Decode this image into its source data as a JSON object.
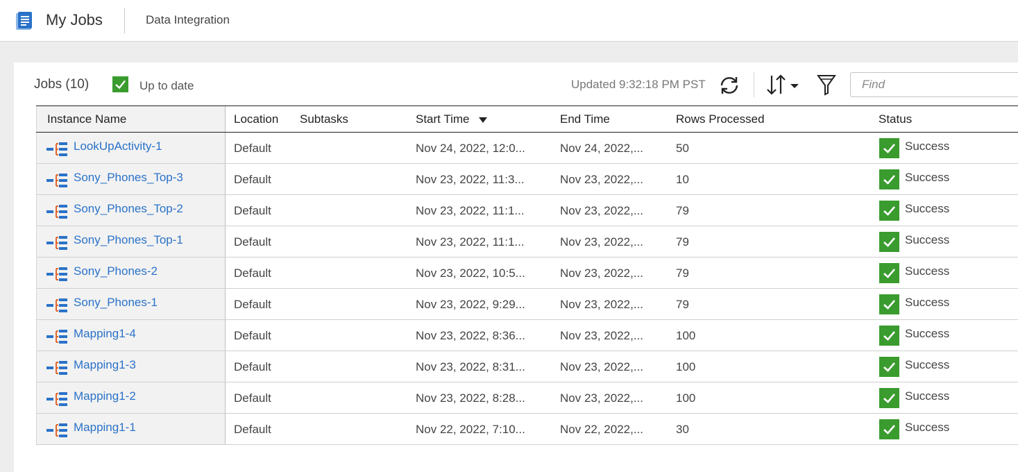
{
  "header": {
    "title": "My Jobs",
    "subtitle": "Data Integration"
  },
  "toolbar": {
    "jobs_label": "Jobs (10)",
    "uptodate_label": "Up to date",
    "updated_text": "Updated 9:32:18 PM PST",
    "find_placeholder": "Find"
  },
  "columns": {
    "instance_name": "Instance Name",
    "location": "Location",
    "subtasks": "Subtasks",
    "start_time": "Start Time",
    "end_time": "End Time",
    "rows_processed": "Rows Processed",
    "status": "Status"
  },
  "colors": {
    "link": "#2a72c8",
    "success": "#3a9b2e",
    "icon_blue": "#2a72c8",
    "icon_orange": "#e0662a"
  },
  "rows": [
    {
      "name": "LookUpActivity-1",
      "location": "Default",
      "start": "Nov 24, 2022, 12:0...",
      "end": "Nov 24, 2022,...",
      "rows": "50",
      "status": "Success"
    },
    {
      "name": "Sony_Phones_Top-3",
      "location": "Default",
      "start": "Nov 23, 2022, 11:3...",
      "end": "Nov 23, 2022,...",
      "rows": "10",
      "status": "Success"
    },
    {
      "name": "Sony_Phones_Top-2",
      "location": "Default",
      "start": "Nov 23, 2022, 11:1...",
      "end": "Nov 23, 2022,...",
      "rows": "79",
      "status": "Success"
    },
    {
      "name": "Sony_Phones_Top-1",
      "location": "Default",
      "start": "Nov 23, 2022, 11:1...",
      "end": "Nov 23, 2022,...",
      "rows": "79",
      "status": "Success"
    },
    {
      "name": "Sony_Phones-2",
      "location": "Default",
      "start": "Nov 23, 2022, 10:5...",
      "end": "Nov 23, 2022,...",
      "rows": "79",
      "status": "Success"
    },
    {
      "name": "Sony_Phones-1",
      "location": "Default",
      "start": "Nov 23, 2022, 9:29...",
      "end": "Nov 23, 2022,...",
      "rows": "79",
      "status": "Success"
    },
    {
      "name": "Mapping1-4",
      "location": "Default",
      "start": "Nov 23, 2022, 8:36...",
      "end": "Nov 23, 2022,...",
      "rows": "100",
      "status": "Success"
    },
    {
      "name": "Mapping1-3",
      "location": "Default",
      "start": "Nov 23, 2022, 8:31...",
      "end": "Nov 23, 2022,...",
      "rows": "100",
      "status": "Success"
    },
    {
      "name": "Mapping1-2",
      "location": "Default",
      "start": "Nov 23, 2022, 8:28...",
      "end": "Nov 23, 2022,...",
      "rows": "100",
      "status": "Success"
    },
    {
      "name": "Mapping1-1",
      "location": "Default",
      "start": "Nov 22, 2022, 7:10...",
      "end": "Nov 22, 2022,...",
      "rows": "30",
      "status": "Success"
    }
  ]
}
